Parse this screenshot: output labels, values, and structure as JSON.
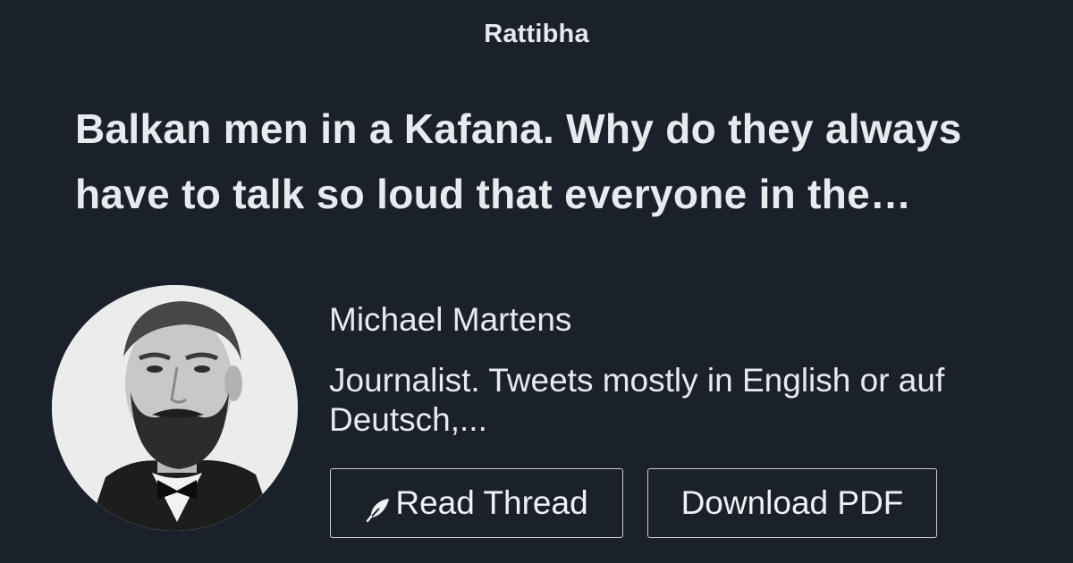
{
  "brand": {
    "name": "Rattibha"
  },
  "thread": {
    "title": "Balkan men in a Kafana. Why do they always have to talk so loud that everyone in the…"
  },
  "author": {
    "name": "Michael Martens",
    "bio": "Journalist. Tweets mostly in English or auf Deutsch,...",
    "avatar_icon": "portrait-photo"
  },
  "actions": {
    "read_thread_label": "Read Thread",
    "read_thread_icon": "feather-icon",
    "download_pdf_label": "Download PDF"
  },
  "colors": {
    "background": "#1b212b",
    "text": "#e7eaee",
    "button_border": "#c9ced6"
  }
}
